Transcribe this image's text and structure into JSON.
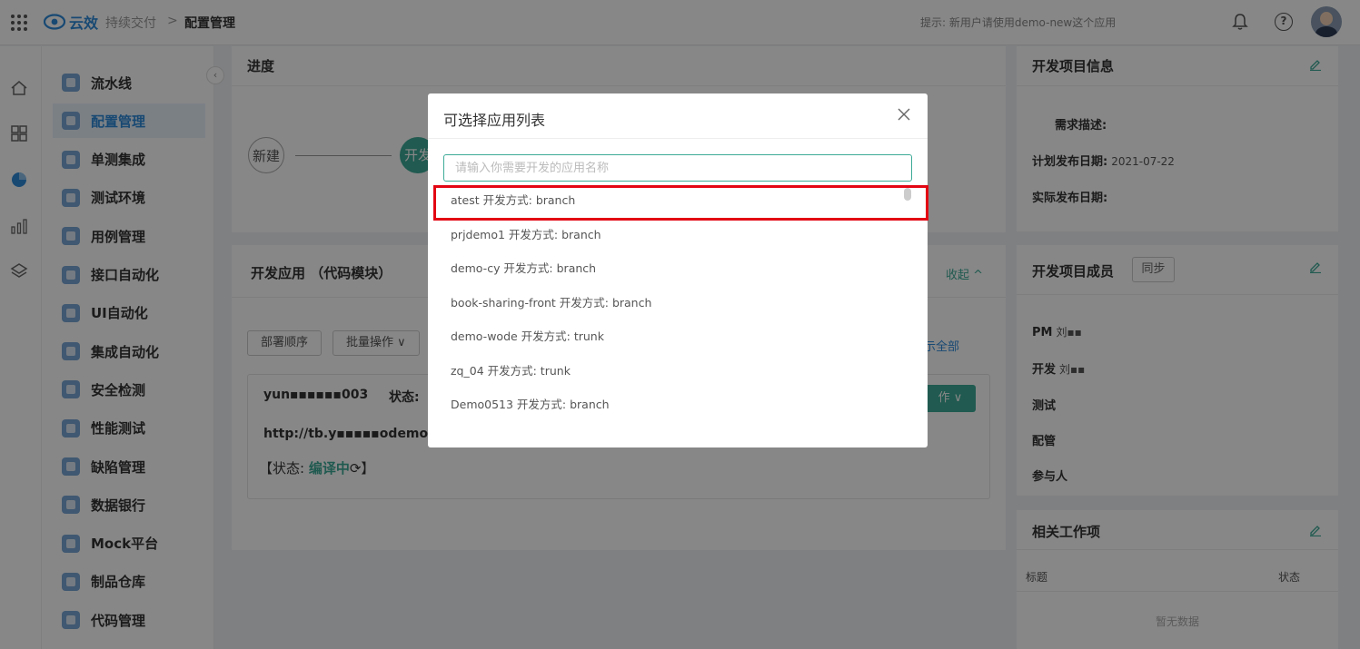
{
  "topbar": {
    "logo_text": "云效",
    "breadcrumb": [
      "持续交付",
      ">",
      "配置管理"
    ],
    "tip": "提示: 新用户请使用demo-new这个应用",
    "help_glyph": "?"
  },
  "rail_icons": [
    "home-icon",
    "dashboard-icon",
    "pie-chart-icon",
    "bar-chart-icon",
    "layers-icon"
  ],
  "menu": {
    "items": [
      {
        "label": "流水线",
        "icon": "pipeline-icon"
      },
      {
        "label": "配置管理",
        "icon": "wrench-icon",
        "active": true
      },
      {
        "label": "单测集成",
        "icon": "unit-test-icon"
      },
      {
        "label": "测试环境",
        "icon": "cloud-icon"
      },
      {
        "label": "用例管理",
        "icon": "case-icon"
      },
      {
        "label": "接口自动化",
        "icon": "api-icon"
      },
      {
        "label": "UI自动化",
        "icon": "ui-icon"
      },
      {
        "label": "集成自动化",
        "icon": "integration-icon"
      },
      {
        "label": "安全检测",
        "icon": "security-icon"
      },
      {
        "label": "性能测试",
        "icon": "performance-icon"
      },
      {
        "label": "缺陷管理",
        "icon": "bug-icon"
      },
      {
        "label": "数据银行",
        "icon": "data-icon"
      },
      {
        "label": "Mock平台",
        "icon": "mock-icon"
      },
      {
        "label": "制品仓库",
        "icon": "artifact-icon"
      },
      {
        "label": "代码管理",
        "icon": "code-icon"
      }
    ],
    "collapse_glyph": "‹"
  },
  "progress": {
    "title": "进度",
    "steps": [
      "新建",
      "开发"
    ]
  },
  "apps": {
    "title": "开发应用 （代码模块）",
    "collapse": "收起 ^",
    "deploy_order": "部署顺序",
    "batch_ops": "批量操作 ∨",
    "show_all": "示全部",
    "card": {
      "name": "yun▪▪▪▪▪▪003",
      "status_label": "状态:",
      "url": "http://tb.y▪▪▪▪▪odemo.co",
      "state_prefix": "【状态: ",
      "state_value": "编译中",
      "state_suffix": "】",
      "op_button": "作 ∨"
    }
  },
  "project_info": {
    "title": "开发项目信息",
    "desc_label": "需求描述:",
    "plan_label": "计划发布日期:",
    "plan_value": "2021-07-22",
    "actual_label": "实际发布日期:"
  },
  "members": {
    "title": "开发项目成员",
    "sync": "同步",
    "rows": [
      {
        "label": "PM",
        "value": "刘▪▪"
      },
      {
        "label": "开发",
        "value": "刘▪▪"
      },
      {
        "label": "测试",
        "value": ""
      },
      {
        "label": "配管",
        "value": ""
      },
      {
        "label": "参与人",
        "value": ""
      }
    ]
  },
  "work_items": {
    "title": "相关工作项",
    "col_title": "标题",
    "col_status": "状态",
    "empty": "暂无数据"
  },
  "modal": {
    "title": "可选择应用列表",
    "search_placeholder": "请输入你需要开发的应用名称",
    "search_value": "",
    "options": [
      "atest 开发方式: branch",
      "prjdemo1 开发方式: branch",
      "demo-cy 开发方式: branch",
      "book-sharing-front 开发方式: branch",
      "demo-wode 开发方式: trunk",
      "zq_04 开发方式: trunk",
      "Demo0513 开发方式: branch"
    ],
    "highlighted_index": 0
  },
  "colors": {
    "accent": "#3dab97",
    "brand": "#2e8bda",
    "highlight": "#e30613"
  }
}
